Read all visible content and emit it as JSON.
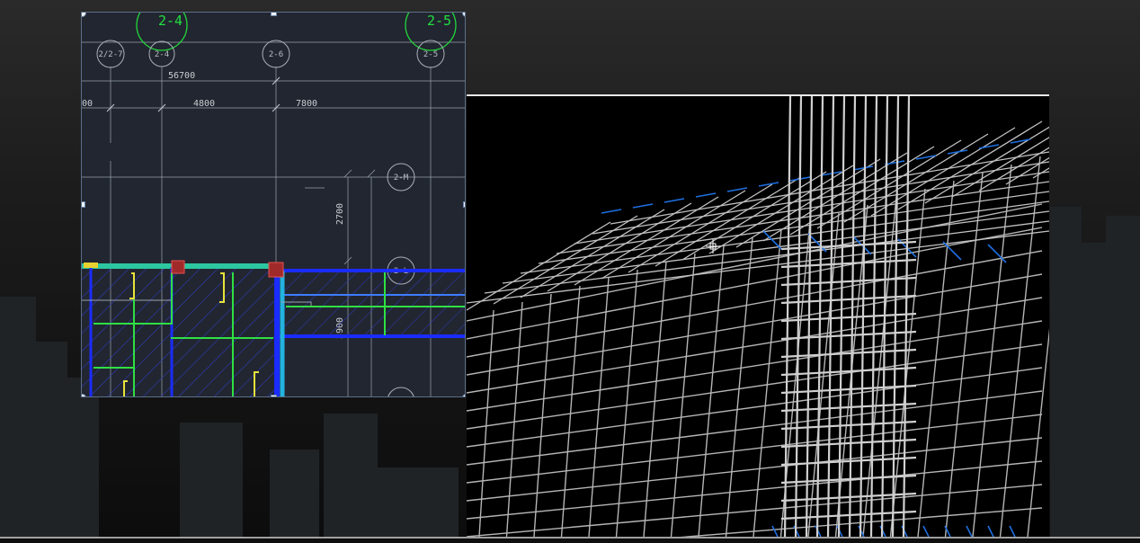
{
  "cad_drawing": {
    "top_axis_labels": [
      "2-4",
      "2-5"
    ],
    "axis_bubbles": [
      "2/2-7",
      "2-4",
      "2-6",
      "2-5"
    ],
    "side_axis_bubbles": [
      "2-M",
      "2-L"
    ],
    "dimensions": {
      "overall": "56700",
      "left_partial": "00",
      "span_a": "4800",
      "span_b": "7800",
      "vertical_a": "2700",
      "vertical_b": "3900"
    }
  },
  "colors": {
    "cad_background": "#222630",
    "beam_blue": "#1a2cff",
    "rebar_green": "#2fe044",
    "slab_hatch": "#2f3ccc",
    "column_red": "#c03030",
    "render_rebar": "#bdbdbd",
    "render_accent": "#1e6fe0"
  }
}
